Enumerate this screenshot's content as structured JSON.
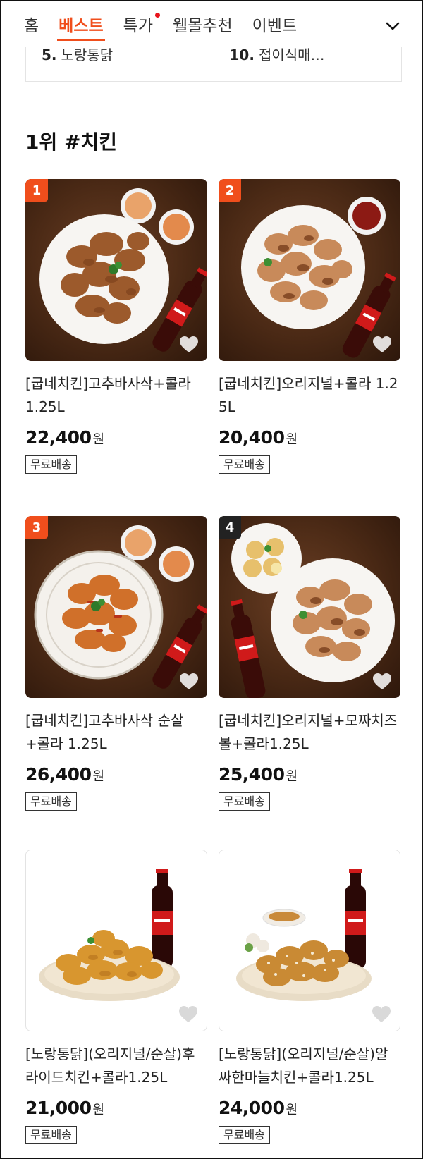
{
  "tabs": [
    {
      "label": "홈",
      "active": false,
      "dot": false
    },
    {
      "label": "베스트",
      "active": true,
      "dot": false
    },
    {
      "label": "특가",
      "active": false,
      "dot": true
    },
    {
      "label": "웰몰추천",
      "active": false,
      "dot": false
    },
    {
      "label": "이벤트",
      "active": false,
      "dot": false
    }
  ],
  "ranking": [
    {
      "num": "5.",
      "name": "노랑통닭"
    },
    {
      "num": "10.",
      "name": "접이식매…"
    }
  ],
  "section_title": "1위 #치킨",
  "products": [
    {
      "rank": "1",
      "badge_color": "#f04e1c",
      "name": "[굽네치킨]고추바사삭+콜라 1.25L",
      "price": "22,400",
      "won": "원",
      "ship": "무료배송"
    },
    {
      "rank": "2",
      "badge_color": "#f04e1c",
      "name": "[굽네치킨]오리지널+콜라 1.25L",
      "price": "20,400",
      "won": "원",
      "ship": "무료배송"
    },
    {
      "rank": "3",
      "badge_color": "#f04e1c",
      "name": "[굽네치킨]고추바사삭 순살+콜라 1.25L",
      "price": "26,400",
      "won": "원",
      "ship": "무료배송"
    },
    {
      "rank": "4",
      "badge_color": "#222222",
      "name": "[굽네치킨]오리지널+모짜치즈볼+콜라1.25L",
      "price": "25,400",
      "won": "원",
      "ship": "무료배송"
    },
    {
      "rank": "",
      "badge_color": "",
      "name": "[노랑통닭](오리지널/순살)후라이드치킨+콜라1.25L",
      "price": "21,000",
      "won": "원",
      "ship": "무료배송"
    },
    {
      "rank": "",
      "badge_color": "",
      "name": "[노랑통닭](오리지널/순살)알싸한마늘치킨+콜라1.25L",
      "price": "24,000",
      "won": "원",
      "ship": "무료배송"
    }
  ],
  "icons": {
    "expand": "chevron-down-icon",
    "wish": "heart-icon"
  },
  "colors": {
    "accent": "#f04e1c",
    "dot": "#e8141c"
  }
}
